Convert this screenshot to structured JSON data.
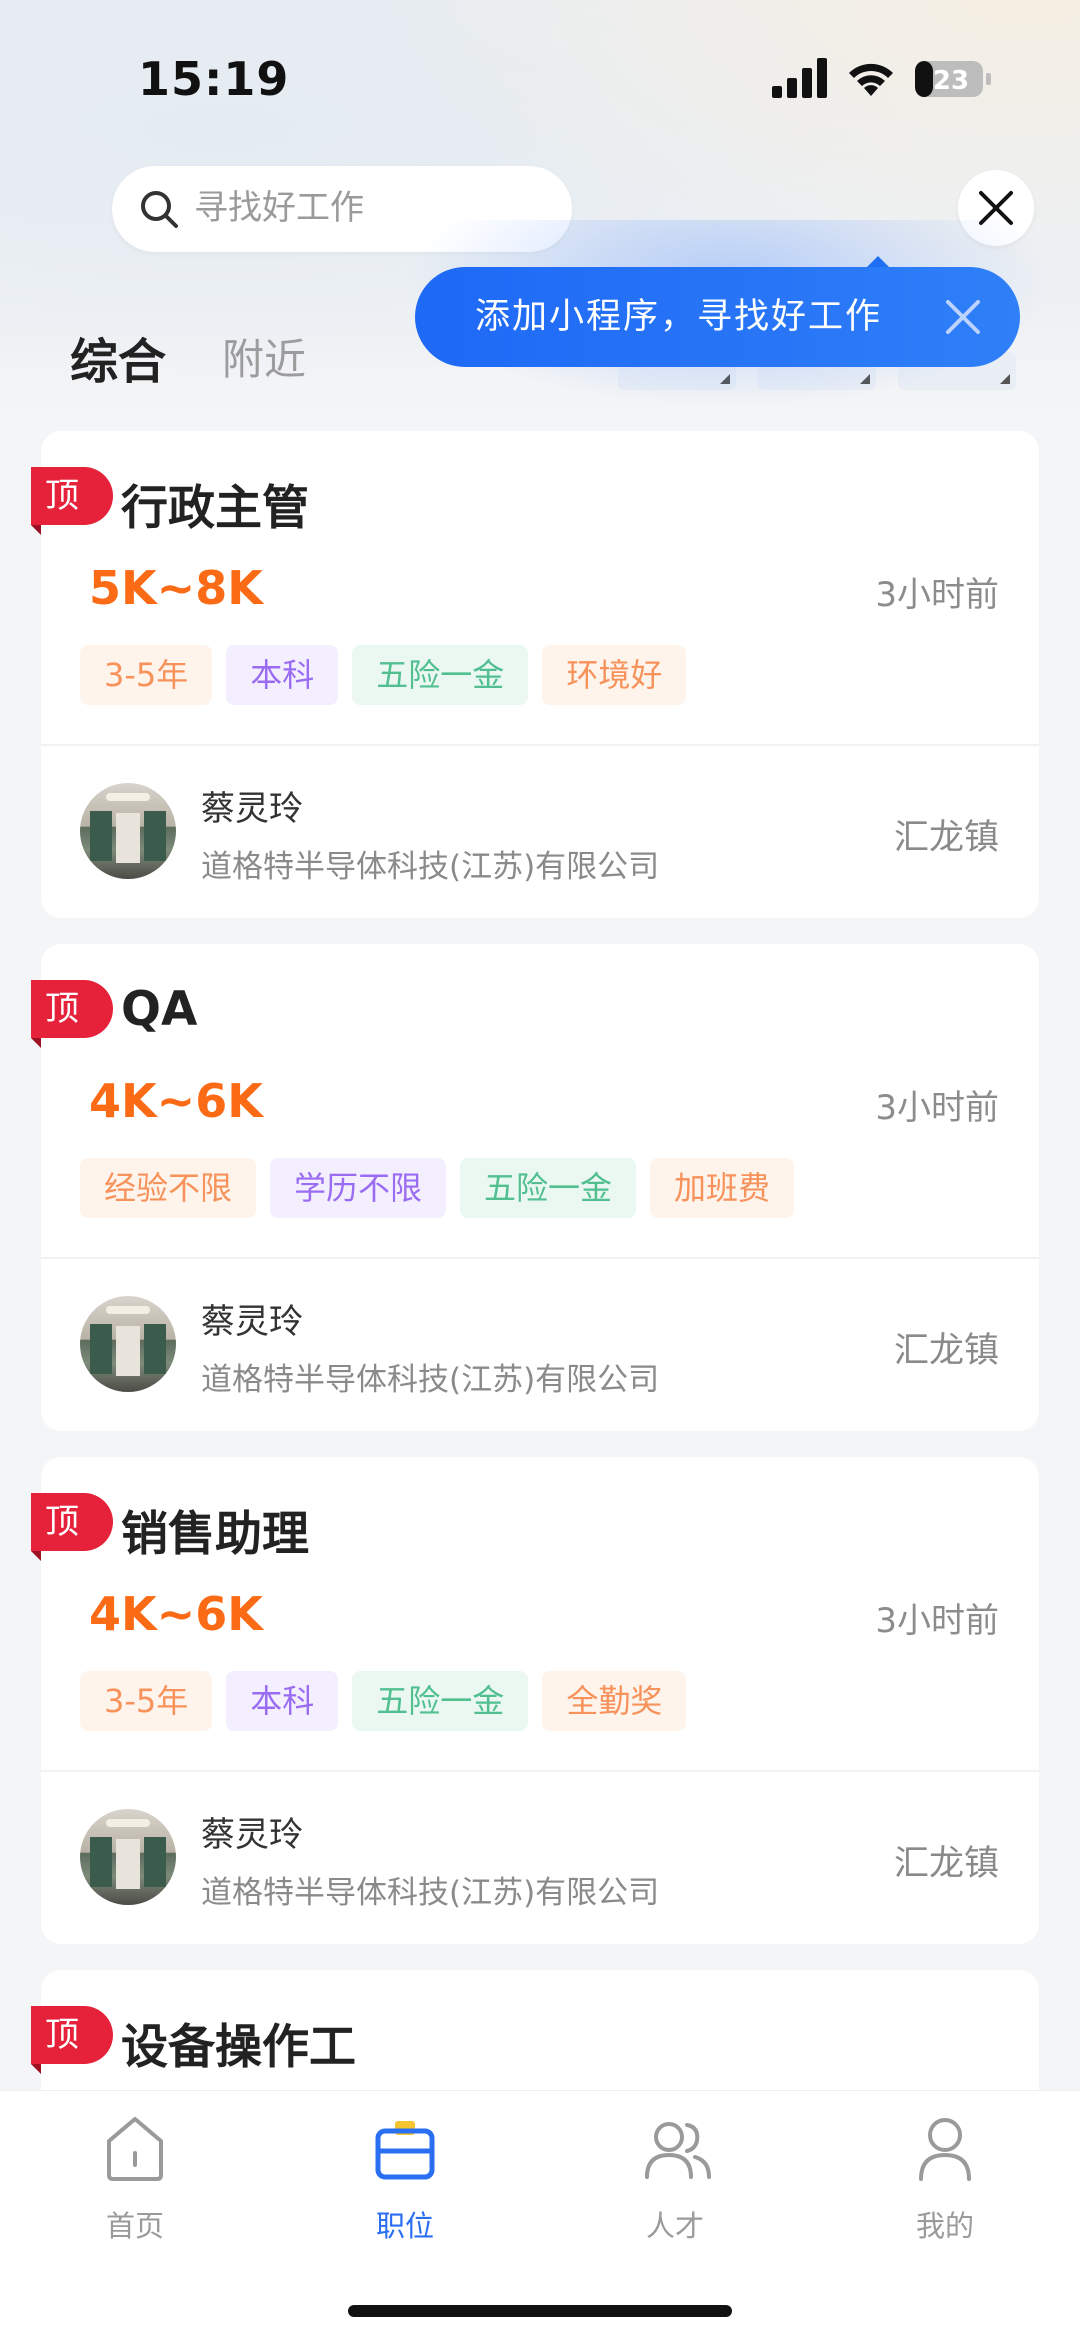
{
  "status_bar": {
    "time": "15:19",
    "battery": "23"
  },
  "search": {
    "placeholder": "寻找好工作"
  },
  "tooltip": {
    "text": "添加小程序，寻找好工作"
  },
  "tabs": [
    {
      "label": "综合"
    },
    {
      "label": "附近"
    }
  ],
  "jobs": [
    {
      "badge": "顶",
      "title": "行政主管",
      "salary": "5K~8K",
      "posted": "3小时前",
      "tags": [
        "3-5年",
        "本科",
        "五险一金",
        "环境好"
      ],
      "recruiter": "蔡灵玲",
      "company": "道格特半导体科技(江苏)有限公司",
      "location": "汇龙镇"
    },
    {
      "badge": "顶",
      "title": "QA",
      "salary": "4K~6K",
      "posted": "3小时前",
      "tags": [
        "经验不限",
        "学历不限",
        "五险一金",
        "加班费"
      ],
      "recruiter": "蔡灵玲",
      "company": "道格特半导体科技(江苏)有限公司",
      "location": "汇龙镇"
    },
    {
      "badge": "顶",
      "title": "销售助理",
      "salary": "4K~6K",
      "posted": "3小时前",
      "tags": [
        "3-5年",
        "本科",
        "五险一金",
        "全勤奖"
      ],
      "recruiter": "蔡灵玲",
      "company": "道格特半导体科技(江苏)有限公司",
      "location": "汇龙镇"
    },
    {
      "badge": "顶",
      "title": "设备操作工"
    }
  ],
  "bottom_nav": [
    {
      "label": "首页",
      "icon": "home-icon",
      "active": false
    },
    {
      "label": "职位",
      "icon": "briefcase-icon",
      "active": true
    },
    {
      "label": "人才",
      "icon": "people-icon",
      "active": false
    },
    {
      "label": "我的",
      "icon": "person-icon",
      "active": false
    }
  ],
  "colors": {
    "accent": "#2a6ef2",
    "salary": "#fb6a14",
    "badge": "#e6213a"
  }
}
